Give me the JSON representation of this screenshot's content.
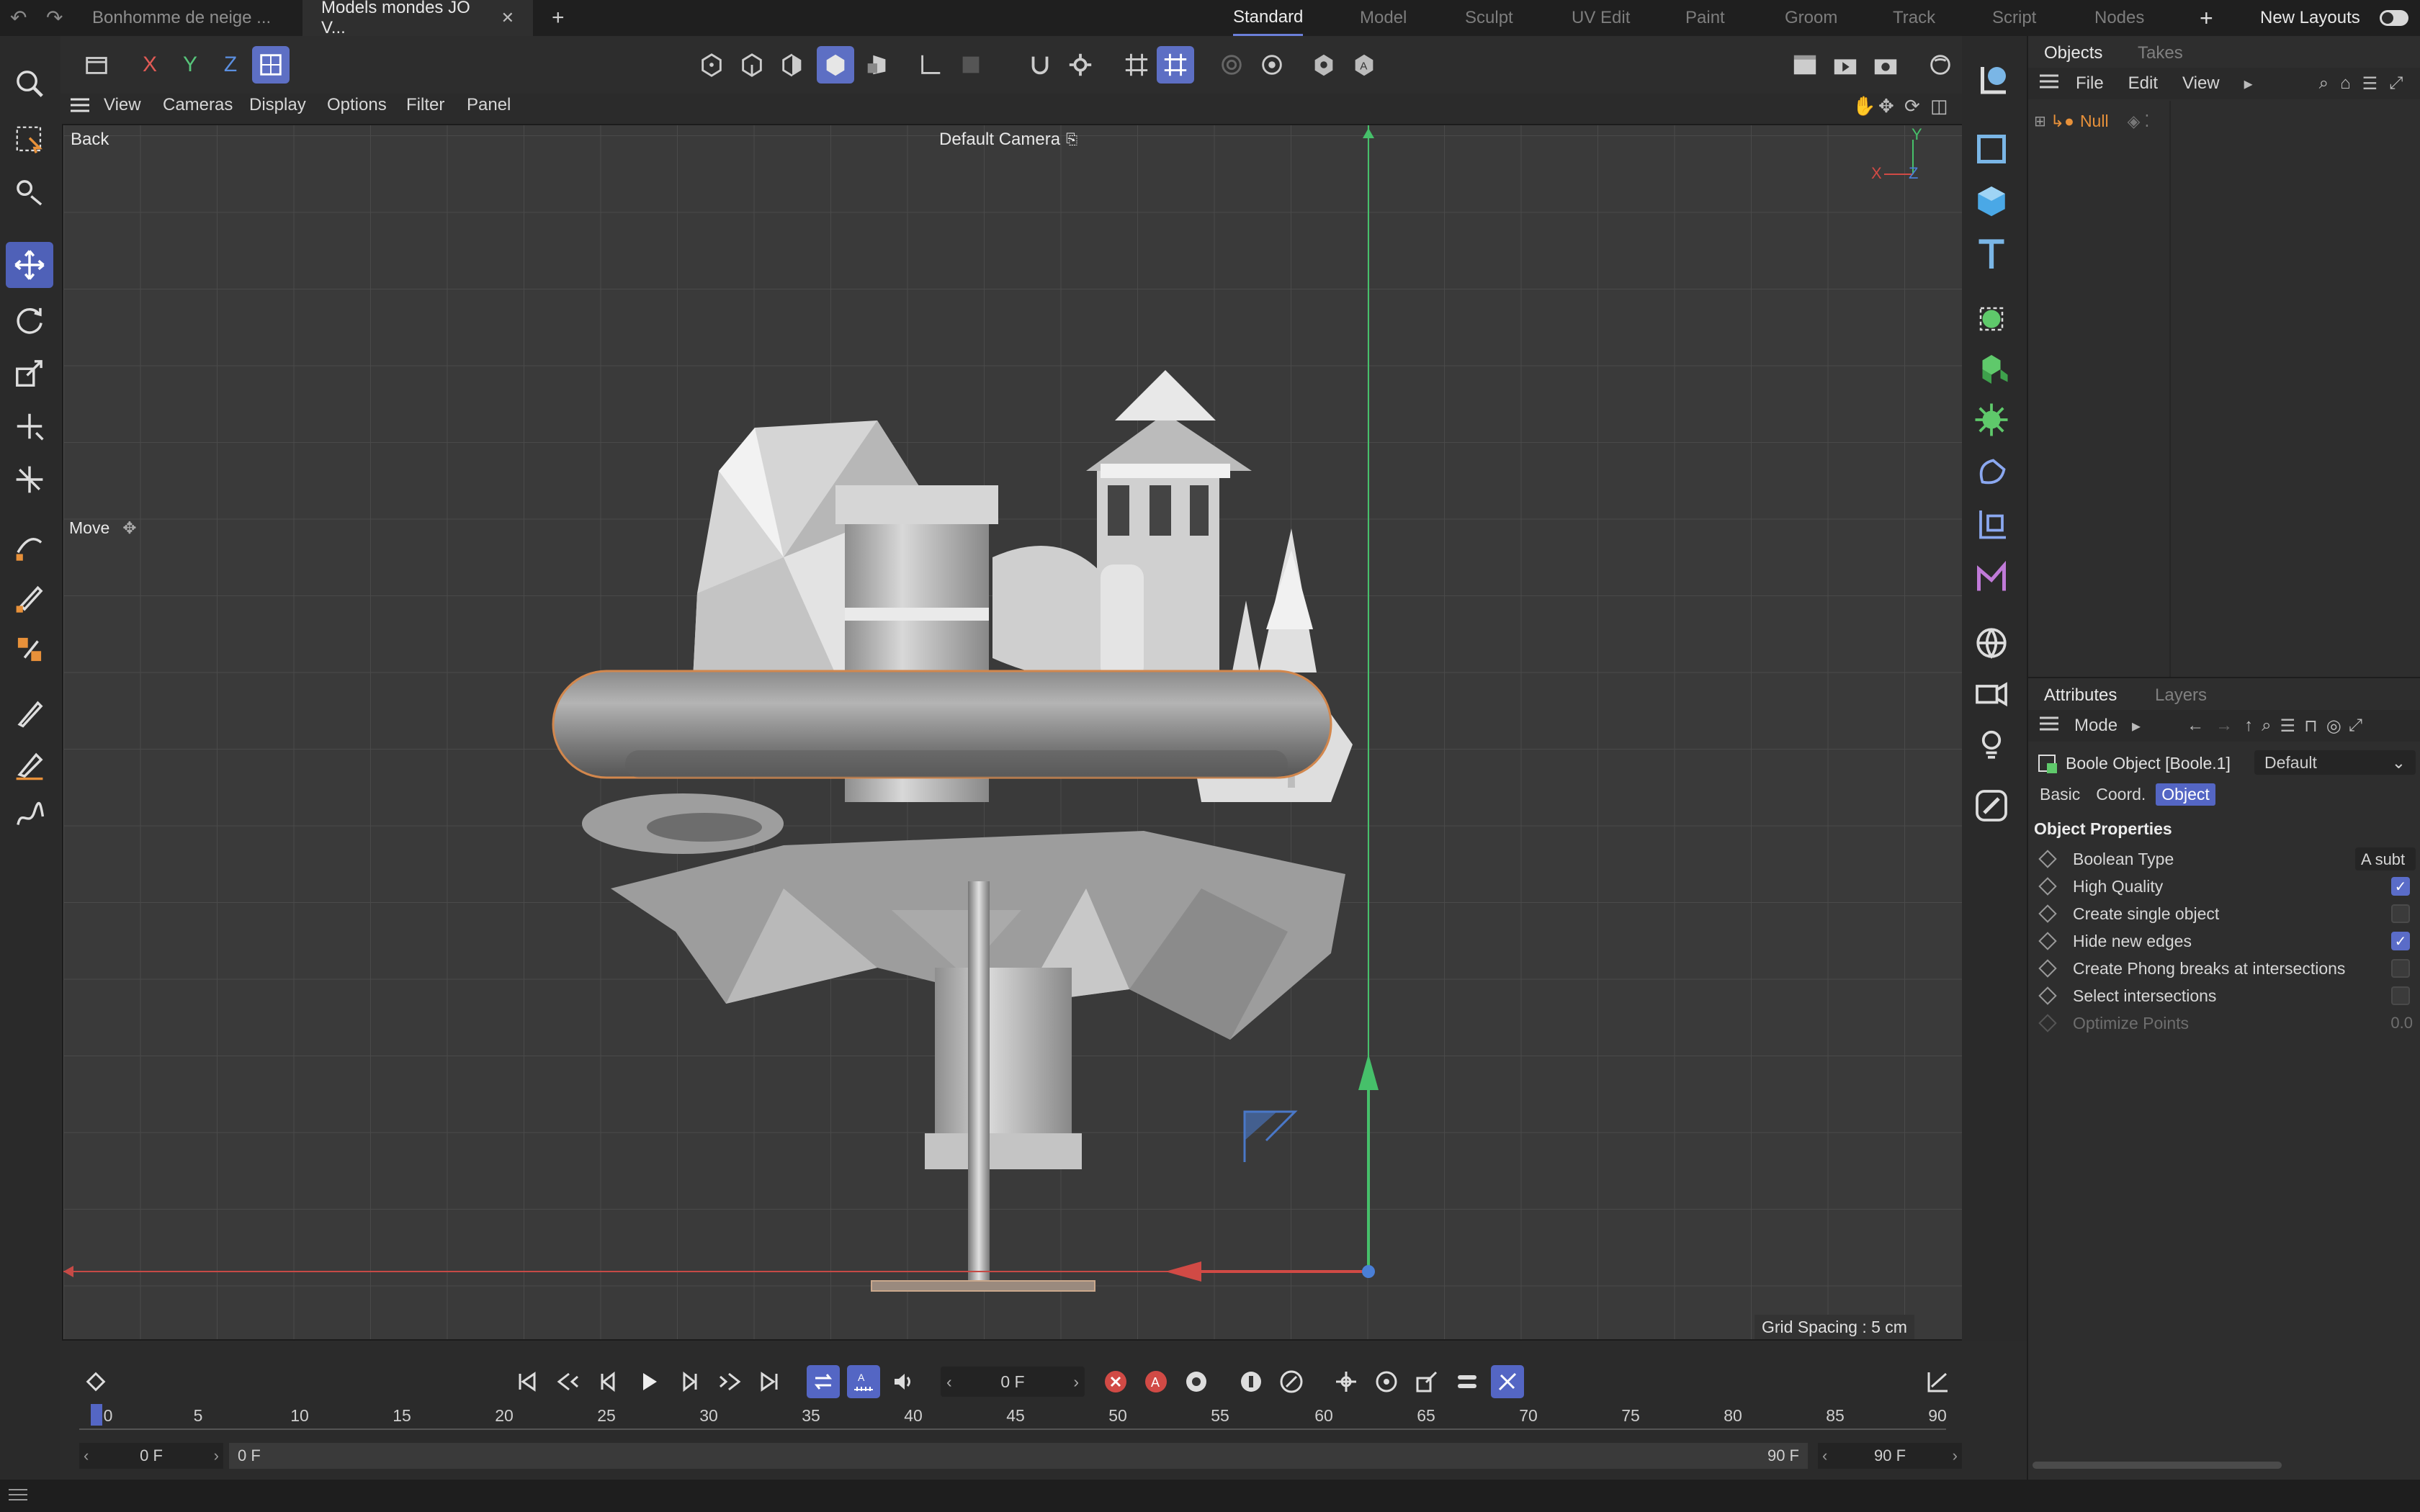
{
  "top_bar": {
    "doc_tabs": [
      "Bonhomme de neige ...",
      "Models mondes JO V...",
      "+"
    ],
    "layout_tabs": [
      "Standard",
      "Model",
      "Sculpt",
      "UV Edit",
      "Paint",
      "Groom",
      "Track",
      "Script",
      "Nodes"
    ],
    "active_layout": "Standard",
    "new_layouts_label": "New Layouts",
    "add_layout": "+"
  },
  "axis_buttons": [
    "X",
    "Y",
    "Z"
  ],
  "viewport_menu": [
    "View",
    "Cameras",
    "Display",
    "Options",
    "Filter",
    "Panel"
  ],
  "viewport": {
    "view_name": "Back",
    "camera": "Default Camera",
    "tool_label": "Move",
    "grid_spacing": "Grid Spacing : 5 cm",
    "axis_labels": {
      "x": "X",
      "y": "Y",
      "z": "Z"
    }
  },
  "objects_panel": {
    "tabs": [
      "Objects",
      "Takes"
    ],
    "menu": [
      "File",
      "Edit",
      "View"
    ],
    "items": [
      {
        "name": "Null"
      }
    ]
  },
  "attributes_panel": {
    "tabs": [
      "Attributes",
      "Layers"
    ],
    "mode_label": "Mode",
    "object_title": "Boole Object [Boole.1]",
    "preset": "Default",
    "subtabs": [
      "Basic",
      "Coord.",
      "Object"
    ],
    "active_subtab": "Object",
    "section": "Object Properties",
    "properties": [
      {
        "label": "Boolean Type",
        "value": "A subt",
        "checked": null
      },
      {
        "label": "High Quality",
        "checked": true
      },
      {
        "label": "Create single object",
        "checked": false
      },
      {
        "label": "Hide new edges",
        "checked": true
      },
      {
        "label": "Create Phong breaks at intersections",
        "checked": false
      },
      {
        "label": "Select intersections",
        "checked": false
      },
      {
        "label": "Optimize Points",
        "value": "0.0",
        "disabled": true
      }
    ]
  },
  "timeline": {
    "current_frame": "0 F",
    "start_frame": "0 F",
    "preview_start": "0 F",
    "preview_end": "90 F",
    "end_frame": "90 F",
    "ruler": [
      "0",
      "5",
      "10",
      "15",
      "20",
      "25",
      "30",
      "35",
      "40",
      "45",
      "50",
      "55",
      "60",
      "65",
      "70",
      "75",
      "80",
      "85",
      "90"
    ]
  },
  "colors": {
    "accent": "#5d6fc4",
    "x_axis": "#d14a45",
    "y_axis": "#46c06a",
    "z_axis": "#4a7fd6",
    "selection_outline": "#d2874d"
  }
}
